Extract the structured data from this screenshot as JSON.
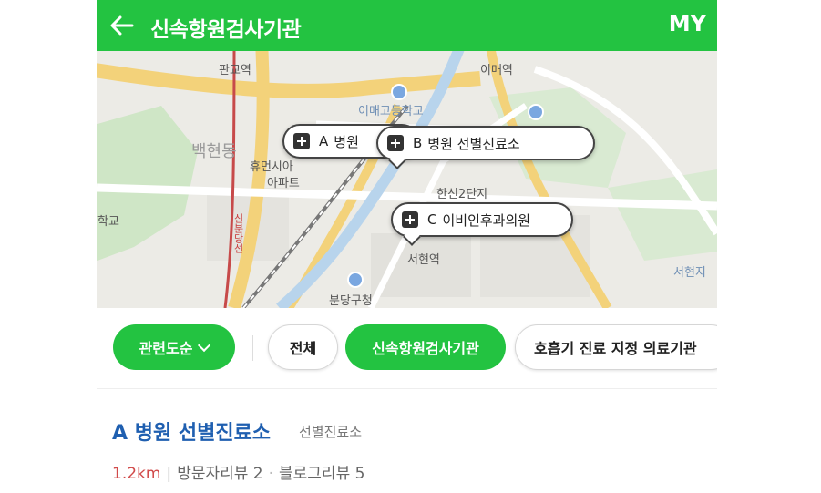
{
  "header": {
    "title": "신속항원검사기관",
    "my_label": "MY",
    "color": "#23c341"
  },
  "map": {
    "labels": {
      "pangyo_station": "판교역",
      "imae_station": "이매역",
      "imae_school": "이매고등학교",
      "baekhyeon": "백현동",
      "huemasi": "휴먼시아",
      "apt": "아파트",
      "hanshin": "한신2단지",
      "school": "학교",
      "sinbundang": "신분당선",
      "seohyeon_station": "서현역",
      "bundang_office": "분당구청",
      "seohyeon_area": "서현지"
    },
    "markers": [
      {
        "letter": "A",
        "name": "병원"
      },
      {
        "letter": "B",
        "name": "병원 선별진료소"
      },
      {
        "letter": "C",
        "name": "이비인후과의원"
      }
    ]
  },
  "filters": {
    "sort_label": "관련도순",
    "chips": [
      "전체",
      "신속항원검사기관",
      "호흡기 진료 지정 의료기관"
    ],
    "active_chip": "신속항원검사기관"
  },
  "result": {
    "letter": "A",
    "name": "병원 선별진료소",
    "category": "선별진료소",
    "distance": "1.2km",
    "visitor_reviews": "방문자리뷰 2",
    "blog_reviews": "블로그리뷰 5"
  }
}
